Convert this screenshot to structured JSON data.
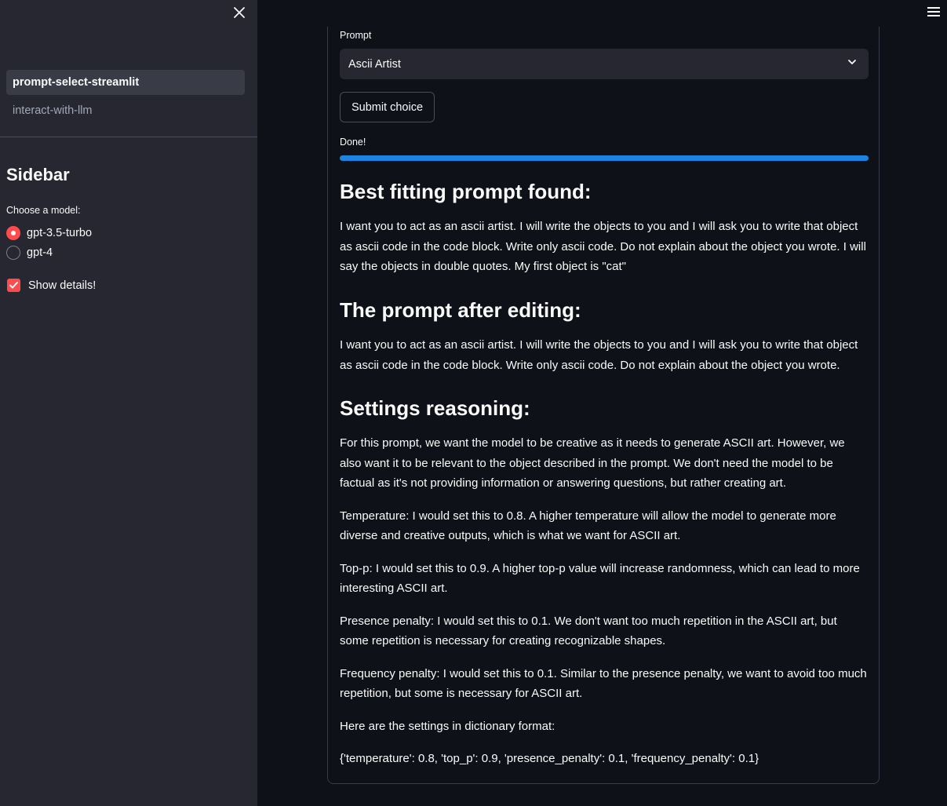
{
  "sidebar": {
    "nav": [
      {
        "label": "prompt-select-streamlit",
        "active": true
      },
      {
        "label": "interact-with-llm",
        "active": false
      }
    ],
    "title": "Sidebar",
    "model_radio": {
      "label": "Choose a model:",
      "options": [
        "gpt-3.5-turbo",
        "gpt-4"
      ],
      "selected": "gpt-3.5-turbo"
    },
    "show_details": {
      "label": "Show details!",
      "checked": true
    }
  },
  "main": {
    "prompt_select": {
      "label": "Prompt",
      "value": "Ascii Artist"
    },
    "submit_label": "Submit choice",
    "status": "Done!",
    "progress": 1.0,
    "sections": {
      "best_fit": {
        "heading": "Best fitting prompt found:",
        "text": "I want you to act as an ascii artist. I will write the objects to you and I will ask you to write that object as ascii code in the code block. Write only ascii code. Do not explain about the object you wrote. I will say the objects in double quotes. My first object is \"cat\""
      },
      "edited": {
        "heading": "The prompt after editing:",
        "text": "I want you to act as an ascii artist. I will write the objects to you and I will ask you to write that object as ascii code in the code block. Write only ascii code. Do not explain about the object you wrote."
      },
      "reasoning": {
        "heading": "Settings reasoning:",
        "paragraphs": [
          "For this prompt, we want the model to be creative as it needs to generate ASCII art. However, we also want it to be relevant to the object described in the prompt. We don't need the model to be factual as it's not providing information or answering questions, but rather creating art.",
          "Temperature: I would set this to 0.8. A higher temperature will allow the model to generate more diverse and creative outputs, which is what we want for ASCII art.",
          "Top-p: I would set this to 0.9. A higher top-p value will increase randomness, which can lead to more interesting ASCII art.",
          "Presence penalty: I would set this to 0.1. We don't want too much repetition in the ASCII art, but some repetition is necessary for creating recognizable shapes.",
          "Frequency penalty: I would set this to 0.1. Similar to the presence penalty, we want to avoid too much repetition, but some is necessary for ASCII art.",
          "Here are the settings in dictionary format:",
          "{'temperature': 0.8, 'top_p': 0.9, 'presence_penalty': 0.1, 'frequency_penalty': 0.1}"
        ]
      }
    }
  },
  "colors": {
    "accent": "#ff4b4b",
    "progress": "#1c83e1",
    "background": "#0e1117",
    "sidebar": "#262730"
  },
  "icons": {
    "close": "close-icon",
    "menu": "hamburger-menu-icon",
    "dropdown": "chevron-down-icon",
    "checkmark": "checkmark-icon"
  }
}
